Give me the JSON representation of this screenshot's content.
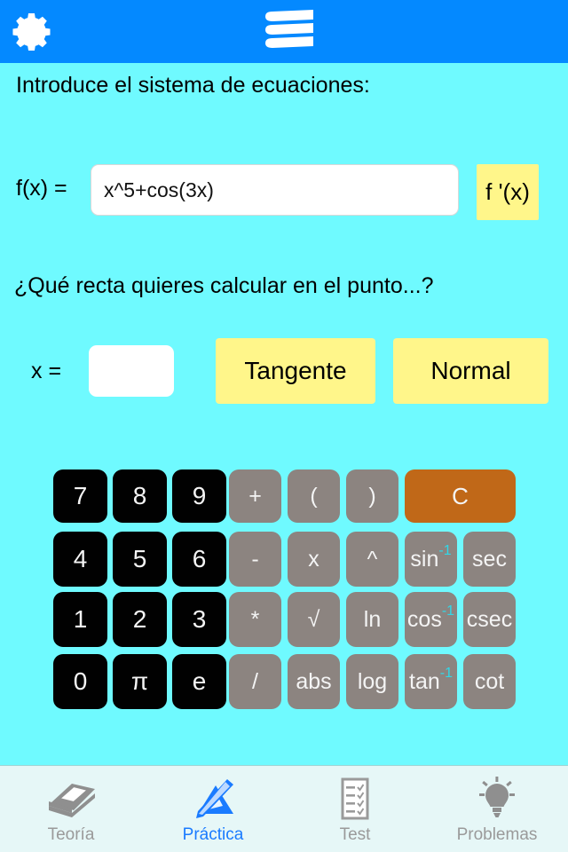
{
  "header": {
    "settings_icon": "gear-icon",
    "logo_icon": "books-stack-icon"
  },
  "main": {
    "prompt_equations": "Introduce el sistema de ecuaciones:",
    "prompt_line": "¿Qué recta quieres calcular en el punto...?",
    "fx_label": "f(x) =",
    "fx_value": "x^5+cos(3x)",
    "fx_placeholder": "",
    "derivative_button": "f '(x)",
    "x_label": "x =",
    "x_value": "",
    "x_placeholder": "",
    "tangente_button": "Tangente",
    "normal_button": "Normal"
  },
  "keypad": {
    "rows": [
      [
        {
          "label": "7",
          "type": "num"
        },
        {
          "label": "8",
          "type": "num"
        },
        {
          "label": "9",
          "type": "num"
        },
        {
          "label": "+",
          "type": "op"
        },
        {
          "label": "(",
          "type": "op"
        },
        {
          "label": ")",
          "type": "op"
        },
        {
          "label": "C",
          "type": "clear",
          "wide": true
        }
      ],
      [
        {
          "label": "4",
          "type": "num"
        },
        {
          "label": "5",
          "type": "num"
        },
        {
          "label": "6",
          "type": "num"
        },
        {
          "label": "-",
          "type": "op"
        },
        {
          "label": "x",
          "type": "op"
        },
        {
          "label": "^",
          "type": "op"
        },
        {
          "label": "sin",
          "sup": "-1",
          "type": "op"
        },
        {
          "label": "sec",
          "type": "op"
        }
      ],
      [
        {
          "label": "1",
          "type": "num"
        },
        {
          "label": "2",
          "type": "num"
        },
        {
          "label": "3",
          "type": "num"
        },
        {
          "label": "*",
          "type": "op"
        },
        {
          "label": "√",
          "type": "op"
        },
        {
          "label": "ln",
          "type": "op"
        },
        {
          "label": "cos",
          "sup": "-1",
          "type": "op"
        },
        {
          "label": "csec",
          "type": "op"
        }
      ],
      [
        {
          "label": "0",
          "type": "num"
        },
        {
          "label": "π",
          "type": "num"
        },
        {
          "label": "e",
          "type": "num"
        },
        {
          "label": "/",
          "type": "op"
        },
        {
          "label": "abs",
          "type": "op"
        },
        {
          "label": "log",
          "type": "op"
        },
        {
          "label": "tan",
          "sup": "-1",
          "type": "op"
        },
        {
          "label": "cot",
          "type": "op"
        }
      ]
    ]
  },
  "tabbar": {
    "items": [
      {
        "label": "Teoría",
        "icon": "book-icon",
        "active": false
      },
      {
        "label": "Práctica",
        "icon": "pencil-triangle-icon",
        "active": true
      },
      {
        "label": "Test",
        "icon": "checklist-icon",
        "active": false
      },
      {
        "label": "Problemas",
        "icon": "lightbulb-icon",
        "active": false
      }
    ]
  },
  "colors": {
    "header_blue": "#0489ff",
    "background_cyan": "#6ffaff",
    "accent_yellow": "#fff68a",
    "clear_orange": "#c06818",
    "op_gray": "#8c8480",
    "num_black": "#010101",
    "sup_cyan": "#30d8e8",
    "tab_active": "#1a7bff",
    "tab_inactive": "#9a9a9a"
  }
}
